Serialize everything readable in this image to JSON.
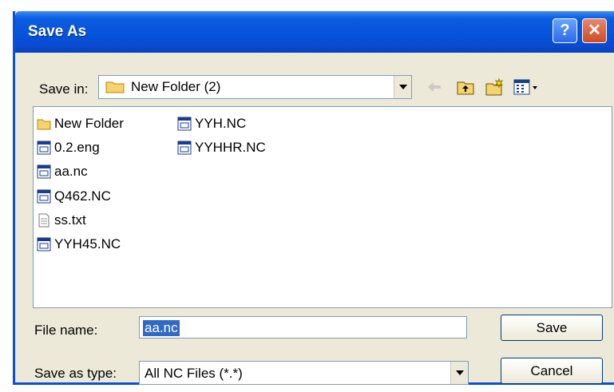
{
  "window": {
    "title": "Save As"
  },
  "titlebar": {
    "help": "?",
    "close": "✕"
  },
  "toolbar": {
    "save_in_label": "Save in:",
    "current_folder": "New Folder (2)"
  },
  "files": [
    {
      "name": "New Folder",
      "icon": "folder-icon"
    },
    {
      "name": "0.2.eng",
      "icon": "nc-file-icon"
    },
    {
      "name": "aa.nc",
      "icon": "nc-file-icon"
    },
    {
      "name": "Q462.NC",
      "icon": "nc-file-icon"
    },
    {
      "name": "ss.txt",
      "icon": "text-file-icon"
    },
    {
      "name": "YYH45.NC",
      "icon": "nc-file-icon"
    },
    {
      "name": "YYH.NC",
      "icon": "nc-file-icon"
    },
    {
      "name": "YYHHR.NC",
      "icon": "nc-file-icon"
    }
  ],
  "form": {
    "file_name_label": "File name:",
    "file_name_value": "aa.nc",
    "save_type_label": "Save as type:",
    "save_type_value": "All NC Files (*.*)"
  },
  "buttons": {
    "save": "Save",
    "cancel": "Cancel"
  },
  "colors": {
    "titlebar": "#0654dc",
    "selection": "#316ac5",
    "dialog_bg": "#ece9d8"
  }
}
